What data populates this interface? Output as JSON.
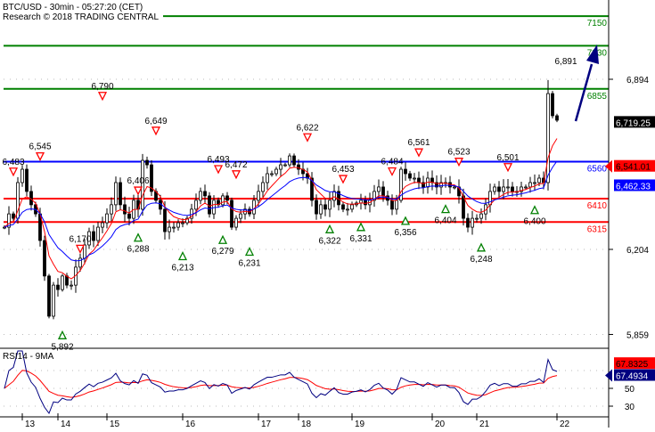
{
  "header": {
    "title": "BTC/USD - 30min - 05:27:20 (CET)",
    "copyright": "Research © 2018 TRADING CENTRAL"
  },
  "chart_data": {
    "type": "candlestick",
    "title": "BTC/USD - 30min - 05:27:20 (CET)",
    "ylim": [
      5800,
      7200
    ],
    "y_ticks": [
      {
        "value": 6894,
        "label": "6,894"
      },
      {
        "value": 6204,
        "label": "6,204"
      },
      {
        "value": 5859,
        "label": "5,859"
      }
    ],
    "x_ticks": [
      {
        "i": 4,
        "label": "13"
      },
      {
        "i": 12,
        "label": "14"
      },
      {
        "i": 23,
        "label": "15"
      },
      {
        "i": 40,
        "label": "16"
      },
      {
        "i": 57,
        "label": "17"
      },
      {
        "i": 66,
        "label": "18"
      },
      {
        "i": 78,
        "label": "19"
      },
      {
        "i": 96,
        "label": "20"
      },
      {
        "i": 106,
        "label": "21"
      },
      {
        "i": 124,
        "label": "22"
      }
    ],
    "levels": [
      {
        "value": 7150,
        "label": "7150",
        "color": "#008000"
      },
      {
        "value": 7030,
        "label": "7030",
        "color": "#008000"
      },
      {
        "value": 6855,
        "label": "6855",
        "color": "#008000"
      },
      {
        "value": 6560,
        "label": "6560",
        "color": "#0000ff"
      },
      {
        "value": 6410,
        "label": "6410",
        "color": "#ff0000"
      },
      {
        "value": 6315,
        "label": "6315",
        "color": "#ff0000"
      }
    ],
    "price_tags": [
      {
        "value": 6719.25,
        "label": "6,719.25",
        "bg": "#000000",
        "fg": "#ffffff"
      },
      {
        "value": 6541.01,
        "label": "6,541.01",
        "bg": "#ff0000",
        "fg": "#000000",
        "arrow": true
      },
      {
        "value": 6462.33,
        "label": "6,462.33",
        "bg": "#0000ff",
        "fg": "#ffffff"
      }
    ],
    "closes": [
      6294,
      6348,
      6330,
      6475,
      6529,
      6439,
      6385,
      6348,
      6240,
      6096,
      5933,
      6059,
      6041,
      6096,
      6059,
      6059,
      6132,
      6168,
      6222,
      6276,
      6240,
      6294,
      6312,
      6348,
      6385,
      6475,
      6385,
      6348,
      6330,
      6403,
      6367,
      6565,
      6547,
      6439,
      6403,
      6367,
      6276,
      6294,
      6294,
      6312,
      6312,
      6330,
      6367,
      6403,
      6439,
      6421,
      6348,
      6403,
      6385,
      6421,
      6403,
      6294,
      6330,
      6348,
      6367,
      6348,
      6403,
      6439,
      6475,
      6511,
      6511,
      6529,
      6547,
      6547,
      6583,
      6547,
      6529,
      6511,
      6493,
      6403,
      6348,
      6385,
      6367,
      6403,
      6439,
      6385,
      6367,
      6367,
      6385,
      6392,
      6403,
      6385,
      6403,
      6439,
      6457,
      6421,
      6403,
      6367,
      6403,
      6529,
      6511,
      6493,
      6493,
      6475,
      6457,
      6493,
      6475,
      6457,
      6475,
      6475,
      6457,
      6457,
      6421,
      6330,
      6294,
      6330,
      6330,
      6348,
      6385,
      6439,
      6457,
      6439,
      6457,
      6457,
      6439,
      6439,
      6457,
      6457,
      6475,
      6475,
      6493,
      6475,
      6836,
      6746,
      6728
    ],
    "annotations": [
      {
        "i": 2,
        "value": 6483,
        "label": "6,483",
        "type": "high"
      },
      {
        "i": 8,
        "value": 6545,
        "label": "6,545",
        "type": "high"
      },
      {
        "i": 13,
        "value": 5892,
        "label": "5,892",
        "type": "low"
      },
      {
        "i": 17,
        "value": 6170,
        "label": "6,170",
        "type": "high"
      },
      {
        "i": 22,
        "value": 6790,
        "label": "6,790",
        "type": "high"
      },
      {
        "i": 30,
        "value": 6406,
        "label": "6,406",
        "type": "high"
      },
      {
        "i": 30,
        "value": 6288,
        "label": "6,288",
        "type": "low"
      },
      {
        "i": 34,
        "value": 6649,
        "label": "6,649",
        "type": "high"
      },
      {
        "i": 40,
        "value": 6213,
        "label": "6,213",
        "type": "low"
      },
      {
        "i": 48,
        "value": 6493,
        "label": "6,493",
        "type": "high"
      },
      {
        "i": 49,
        "value": 6279,
        "label": "6,279",
        "type": "low"
      },
      {
        "i": 52,
        "value": 6472,
        "label": "6,472",
        "type": "high"
      },
      {
        "i": 55,
        "value": 6231,
        "label": "6,231",
        "type": "low"
      },
      {
        "i": 68,
        "value": 6622,
        "label": "6,622",
        "type": "high"
      },
      {
        "i": 73,
        "value": 6322,
        "label": "6,322",
        "type": "low"
      },
      {
        "i": 76,
        "value": 6453,
        "label": "6,453",
        "type": "high"
      },
      {
        "i": 80,
        "value": 6331,
        "label": "6,331",
        "type": "low"
      },
      {
        "i": 87,
        "value": 6484,
        "label": "6,484",
        "type": "high"
      },
      {
        "i": 90,
        "value": 6356,
        "label": "6,356",
        "type": "low"
      },
      {
        "i": 93,
        "value": 6561,
        "label": "6,561",
        "type": "high"
      },
      {
        "i": 99,
        "value": 6404,
        "label": "6,404",
        "type": "low"
      },
      {
        "i": 102,
        "value": 6523,
        "label": "6,523",
        "type": "high"
      },
      {
        "i": 107,
        "value": 6248,
        "label": "6,248",
        "type": "low"
      },
      {
        "i": 113,
        "value": 6501,
        "label": "6,501",
        "type": "high"
      },
      {
        "i": 119,
        "value": 6400,
        "label": "6,400",
        "type": "low"
      },
      {
        "i": 126,
        "value": 6891,
        "label": "6,891",
        "type": "high",
        "no_marker": true
      }
    ],
    "rsi": {
      "label": "RSI14 - 9MA",
      "ylim": [
        20,
        95
      ],
      "y_ticks": [
        {
          "value": 50,
          "label": "50"
        },
        {
          "value": 30,
          "label": "30"
        }
      ],
      "tags": [
        {
          "value": 67.8325,
          "label": "67.8325",
          "bg": "#ff0000",
          "fg": "#000000"
        },
        {
          "value": 67.4934,
          "label": "67.4934",
          "bg": "#000080",
          "fg": "#ffffff",
          "arrow": true
        }
      ]
    },
    "colors": {
      "rsi": "#000080",
      "ma_fast": "#ff0000",
      "ma_slow": "#0000ff",
      "arrow": "#000080",
      "high_marker": "#ff0000",
      "low_marker": "#008000"
    }
  }
}
